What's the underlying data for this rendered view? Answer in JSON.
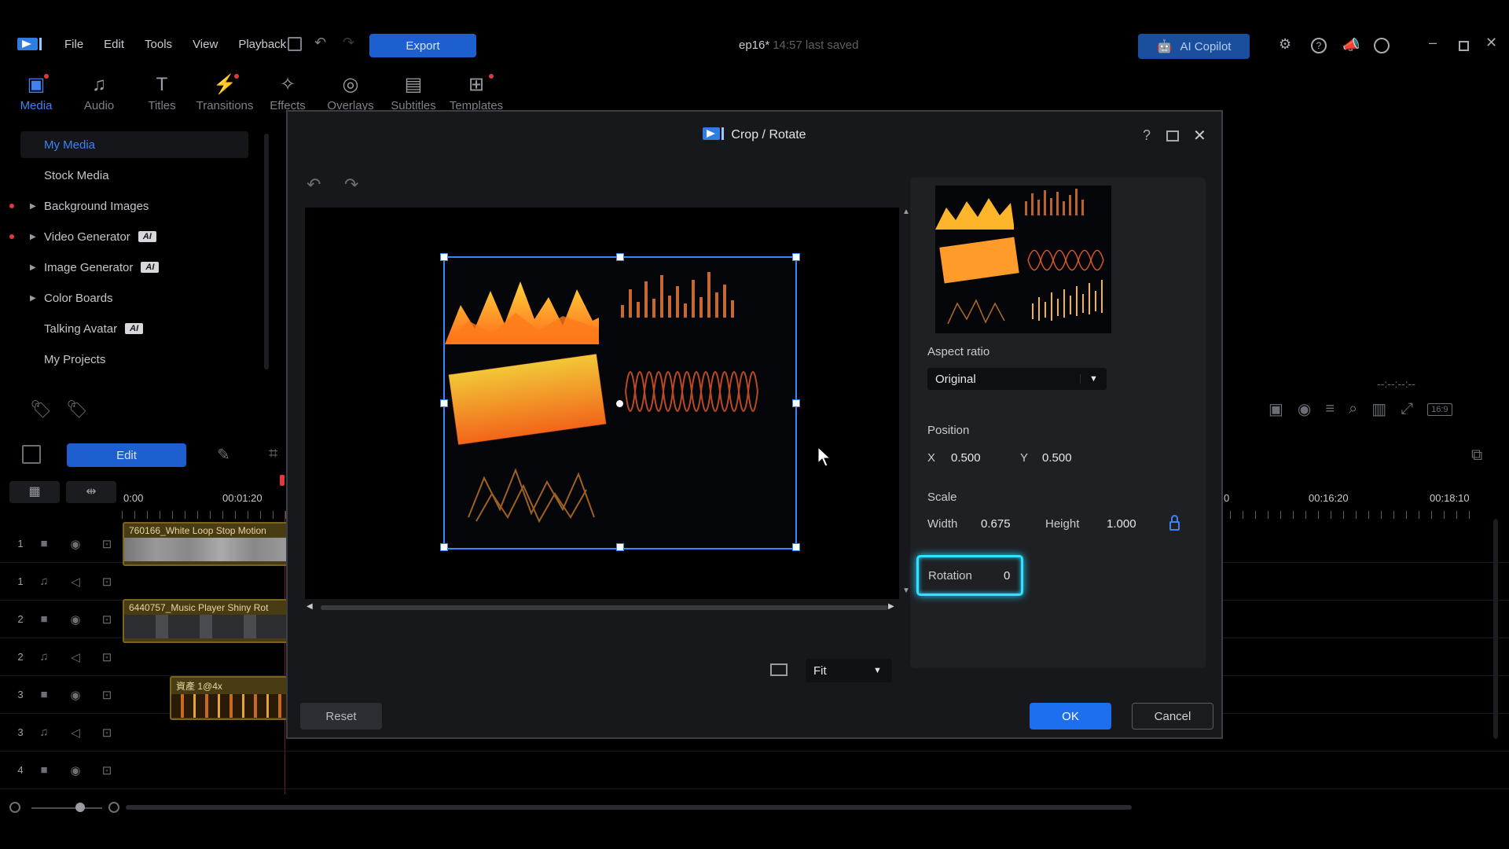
{
  "menu": [
    "File",
    "Edit",
    "Tools",
    "View",
    "Playback"
  ],
  "export_label": "Export",
  "project_title": "ep16*",
  "save_status": "14:57 last saved",
  "ai_copilot_label": "AI Copilot",
  "tool_tabs": [
    {
      "label": "Media",
      "icon": "media-icon"
    },
    {
      "label": "Audio",
      "icon": "music-note-icon"
    },
    {
      "label": "Titles",
      "icon": "title-t-icon"
    },
    {
      "label": "Transitions",
      "icon": "transitions-icon"
    },
    {
      "label": "Effects",
      "icon": "effects-icon"
    },
    {
      "label": "Overlays",
      "icon": "overlays-icon"
    },
    {
      "label": "Subtitles",
      "icon": "subtitles-icon"
    },
    {
      "label": "Templates",
      "icon": "templates-icon"
    }
  ],
  "library": [
    {
      "label": "My Media",
      "ai": ""
    },
    {
      "label": "Stock Media",
      "ai": ""
    },
    {
      "label": "Background Images",
      "ai": ""
    },
    {
      "label": "Video Generator",
      "ai": "AI"
    },
    {
      "label": "Image Generator",
      "ai": "AI"
    },
    {
      "label": "Color Boards",
      "ai": ""
    },
    {
      "label": "Talking Avatar",
      "ai": "AI"
    },
    {
      "label": "My Projects",
      "ai": ""
    }
  ],
  "edit_label": "Edit",
  "timeline": {
    "ruler": [
      "0:00",
      "00:01:20",
      "0",
      "00:16:20",
      "00:18:10"
    ],
    "timecode_placeholder": "--:--:--:--",
    "aspect_badge": "16:9",
    "tracks": [
      {
        "num": "1",
        "type": "video"
      },
      {
        "num": "1",
        "type": "audio"
      },
      {
        "num": "2",
        "type": "video"
      },
      {
        "num": "2",
        "type": "audio"
      },
      {
        "num": "3",
        "type": "video"
      },
      {
        "num": "3",
        "type": "audio"
      },
      {
        "num": "4",
        "type": "video"
      }
    ],
    "clips": [
      {
        "label": "760166_White Loop Stop Motion"
      },
      {
        "label": "6440757_Music Player Shiny Rot"
      },
      {
        "label": "資產 1@4x"
      }
    ]
  },
  "dialog": {
    "title": "Crop / Rotate",
    "aspect_ratio_label": "Aspect ratio",
    "aspect_ratio_value": "Original",
    "position_label": "Position",
    "x_label": "X",
    "x_value": "0.500",
    "y_label": "Y",
    "y_value": "0.500",
    "scale_label": "Scale",
    "width_label": "Width",
    "width_value": "0.675",
    "height_label": "Height",
    "height_value": "1.000",
    "rotation_label": "Rotation",
    "rotation_value": "0",
    "fit_value": "Fit",
    "reset_label": "Reset",
    "ok_label": "OK",
    "cancel_label": "Cancel"
  },
  "colors": {
    "accent": "#3f82f1",
    "ok_button": "#1e6ff0",
    "export_button": "#1d5fcf",
    "rotation_highlight": "#33e0ff",
    "crop_frame": "#3a86ff"
  }
}
